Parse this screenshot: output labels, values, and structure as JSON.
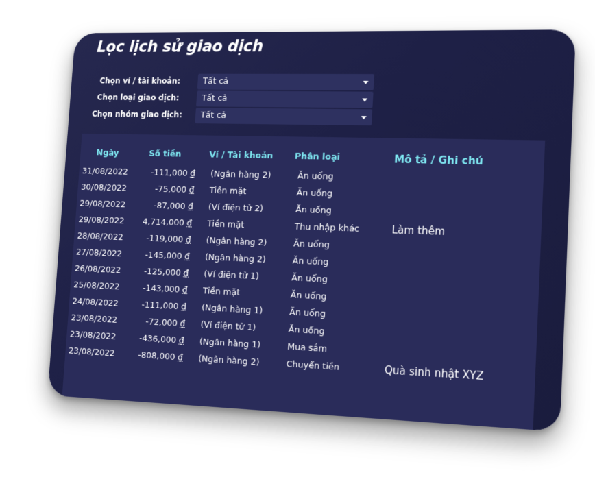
{
  "page": {
    "title": "Lọc lịch sử giao dịch"
  },
  "filters": [
    {
      "label": "Chọn ví / tài khoản:",
      "value": "Tất cả"
    },
    {
      "label": "Chọn loại giao dịch:",
      "value": "Tất cả"
    },
    {
      "label": "Chọn nhóm giao dịch:",
      "value": "Tất cả"
    }
  ],
  "table": {
    "headers": {
      "date": "Ngày",
      "amount": "Số tiền",
      "account": "Ví / Tài khoản",
      "category": "Phân loại",
      "note": "Mô tả / Ghi chú"
    },
    "currency_symbol": "₫",
    "rows": [
      {
        "date": "31/08/2022",
        "amount": "-111,000",
        "account": "(Ngân hàng 2)",
        "category": "Ăn uống",
        "note": ""
      },
      {
        "date": "30/08/2022",
        "amount": "-75,000",
        "account": "Tiền mặt",
        "category": "Ăn uống",
        "note": ""
      },
      {
        "date": "29/08/2022",
        "amount": "-87,000",
        "account": "(Ví điện tử 2)",
        "category": "Ăn uống",
        "note": ""
      },
      {
        "date": "29/08/2022",
        "amount": "4,714,000",
        "account": "Tiền mặt",
        "category": "Thu nhập khác",
        "note": "Làm thêm"
      },
      {
        "date": "28/08/2022",
        "amount": "-119,000",
        "account": "(Ngân hàng 2)",
        "category": "Ăn uống",
        "note": ""
      },
      {
        "date": "27/08/2022",
        "amount": "-145,000",
        "account": "(Ngân hàng 2)",
        "category": "Ăn uống",
        "note": ""
      },
      {
        "date": "26/08/2022",
        "amount": "-125,000",
        "account": "(Ví điện tử 1)",
        "category": "Ăn uống",
        "note": ""
      },
      {
        "date": "25/08/2022",
        "amount": "-143,000",
        "account": "Tiền mặt",
        "category": "Ăn uống",
        "note": ""
      },
      {
        "date": "24/08/2022",
        "amount": "-111,000",
        "account": "(Ngân hàng 1)",
        "category": "Ăn uống",
        "note": ""
      },
      {
        "date": "23/08/2022",
        "amount": "-72,000",
        "account": "(Ví điện tử 1)",
        "category": "Ăn uống",
        "note": ""
      },
      {
        "date": "23/08/2022",
        "amount": "-436,000",
        "account": "(Ngân hàng 1)",
        "category": "Mua sắm",
        "note": ""
      },
      {
        "date": "23/08/2022",
        "amount": "-808,000",
        "account": "(Ngân hàng 2)",
        "category": "Chuyển tiền",
        "note": "Quà sinh nhật XYZ"
      }
    ]
  },
  "colors": {
    "background": "#1e2046",
    "panel": "#2a2c5a",
    "select": "#2e3160",
    "header_accent": "#7fe8f2",
    "text": "#ffffff"
  }
}
